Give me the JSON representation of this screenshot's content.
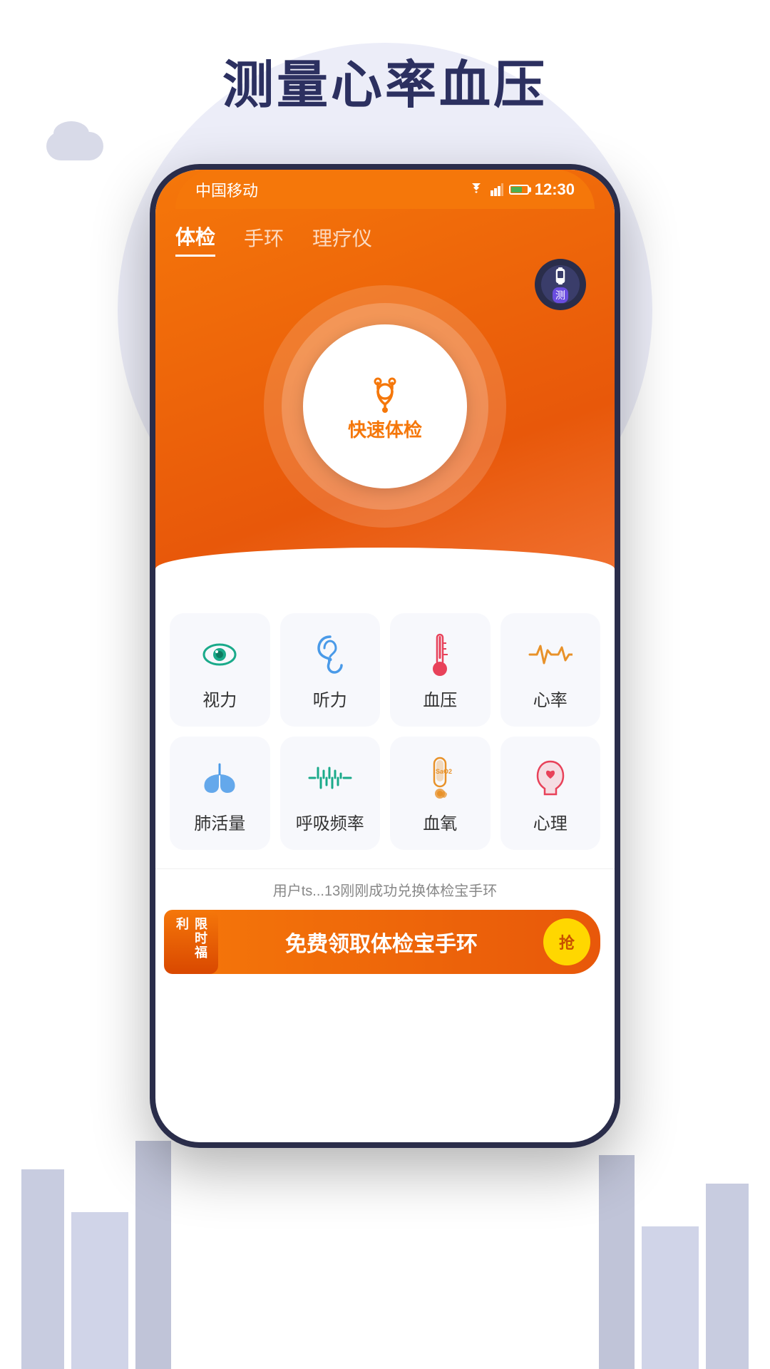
{
  "page": {
    "title": "测量心率血压",
    "background_color": "#f0f0f8"
  },
  "status_bar": {
    "carrier": "中国移动",
    "time": "12:30",
    "battery_level": 70
  },
  "tabs": [
    {
      "id": "exam",
      "label": "体检",
      "active": true
    },
    {
      "id": "band",
      "label": "手环",
      "active": false
    },
    {
      "id": "therapy",
      "label": "理疗仪",
      "active": false
    }
  ],
  "device_badge": {
    "label": "测"
  },
  "main_button": {
    "label": "快速体检"
  },
  "grid": {
    "rows": [
      [
        {
          "id": "vision",
          "label": "视力",
          "icon": "eye"
        },
        {
          "id": "hearing",
          "label": "听力",
          "icon": "ear"
        },
        {
          "id": "bp",
          "label": "血压",
          "icon": "thermometer"
        },
        {
          "id": "heartrate",
          "label": "心率",
          "icon": "heartrate"
        }
      ],
      [
        {
          "id": "lung",
          "label": "肺活量",
          "icon": "lung"
        },
        {
          "id": "breath",
          "label": "呼吸频率",
          "icon": "breath"
        },
        {
          "id": "oxygen",
          "label": "血氧",
          "icon": "oxygen"
        },
        {
          "id": "mental",
          "label": "心理",
          "icon": "mental"
        }
      ]
    ]
  },
  "notification": {
    "text": "用户ts...13刚刚成功兑换体检宝手环"
  },
  "banner": {
    "badge": "限时福利",
    "text": "免费领取体检宝手环",
    "button_label": "抢"
  }
}
